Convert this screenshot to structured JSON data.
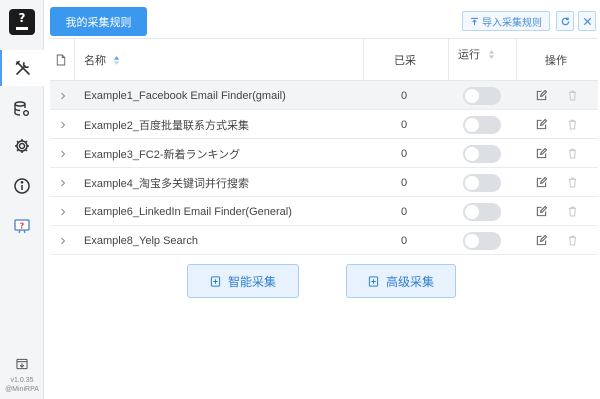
{
  "app": {
    "logo_glyph": "?",
    "version": "v1.0.35",
    "author": "@MiniRPA"
  },
  "sidebar": {
    "items": [
      {
        "icon": "tools-icon",
        "active": true
      },
      {
        "icon": "database-settings-icon",
        "active": false
      },
      {
        "icon": "gear-icon",
        "active": false
      },
      {
        "icon": "info-icon",
        "active": false
      },
      {
        "icon": "help-icon",
        "active": false
      }
    ],
    "bottom_icon": "export-icon"
  },
  "header": {
    "tab_label": "我的采集规则",
    "import_label": "导入采集规则",
    "import_icon": "import-icon",
    "refresh_icon": "refresh-icon",
    "close_icon": "close-icon"
  },
  "table": {
    "headers": {
      "name": "名称",
      "collected": "已采",
      "running": "运行",
      "actions": "操作"
    },
    "rows": [
      {
        "name": "Example1_Facebook Email Finder(gmail)",
        "count": "0",
        "running": false
      },
      {
        "name": "Example2_百度批量联系方式采集",
        "count": "0",
        "running": false
      },
      {
        "name": "Example3_FC2-新着ランキング",
        "count": "0",
        "running": false
      },
      {
        "name": "Example4_淘宝多关键词并行搜索",
        "count": "0",
        "running": false
      },
      {
        "name": "Example6_LinkedIn Email Finder(General)",
        "count": "0",
        "running": false
      },
      {
        "name": "Example8_Yelp Search",
        "count": "0",
        "running": false
      }
    ]
  },
  "actions": {
    "smart_collect": "智能采集",
    "advanced_collect": "高级采集"
  },
  "colors": {
    "primary": "#3a98ef",
    "light_button_bg": "#e8f2fc",
    "switch_off": "#dcdfe4"
  }
}
